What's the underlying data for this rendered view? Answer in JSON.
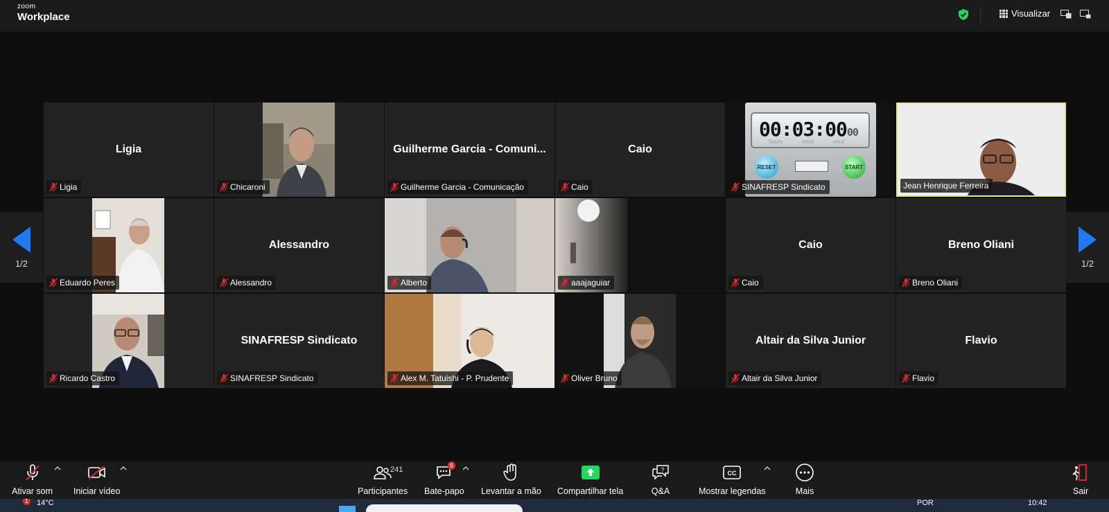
{
  "app": {
    "brand_small": "zoom",
    "brand_big": "Workplace"
  },
  "top": {
    "view_label": "Visualizar"
  },
  "tiles_row1": [
    {
      "name": "Ligia",
      "center": "Ligia"
    },
    {
      "name": "Chicaroni",
      "center": ""
    },
    {
      "name": "Guilherme Garcia - Comunicação",
      "center": "Guilherme Garcia - Comuni..."
    },
    {
      "name": "Caio",
      "center": "Caio"
    },
    {
      "name": "SINAFRESP Sindicato",
      "center": ""
    },
    {
      "name": "Jean Henrique Ferreira",
      "center": ""
    }
  ],
  "tiles_row2": [
    {
      "name": "Eduardo Peres",
      "center": ""
    },
    {
      "name": "Alessandro",
      "center": "Alessandro"
    },
    {
      "name": "Alberto",
      "center": ""
    },
    {
      "name": "aaajaguiar",
      "center": ""
    },
    {
      "name": "Caio",
      "center": "Caio"
    },
    {
      "name": "Breno Oliani",
      "center": "Breno Oliani"
    }
  ],
  "tiles_row3": [
    {
      "name": "Ricardo Castro",
      "center": ""
    },
    {
      "name": "SINAFRESP Sindicato",
      "center": "SINAFRESP Sindicato"
    },
    {
      "name": "Alex M. Tatuishi - P. Prudente",
      "center": ""
    },
    {
      "name": "Oliver Bruno",
      "center": ""
    },
    {
      "name": "Altair da Silva Junior",
      "center": "Altair da Silva Junior"
    },
    {
      "name": "Flavio",
      "center": "Flavio"
    }
  ],
  "timer": {
    "display": "00:03:00",
    "hundredths": "00",
    "units": [
      "hours",
      "mins",
      "secs"
    ],
    "reset": "RESET",
    "start": "START"
  },
  "pager": {
    "left": "1/2",
    "right": "1/2"
  },
  "toolbar": {
    "audio": "Ativar som",
    "video": "Iniciar vídeo",
    "participants": "Participantes",
    "participants_count": "241",
    "chat": "Bate-papo",
    "chat_badge": "8",
    "raise_hand": "Levantar a mão",
    "share": "Compartilhar tela",
    "qa": "Q&A",
    "captions": "Mostrar legendas",
    "more": "Mais",
    "leave": "Sair"
  },
  "taskbar": {
    "notif": "1",
    "weather": "14°C",
    "lang": "POR",
    "time": "10:42"
  },
  "colors": {
    "accent_green": "#23d959",
    "arrow_blue": "#1e7cf0",
    "mute_red": "#e02828",
    "active_speaker": "#e8e87a"
  }
}
